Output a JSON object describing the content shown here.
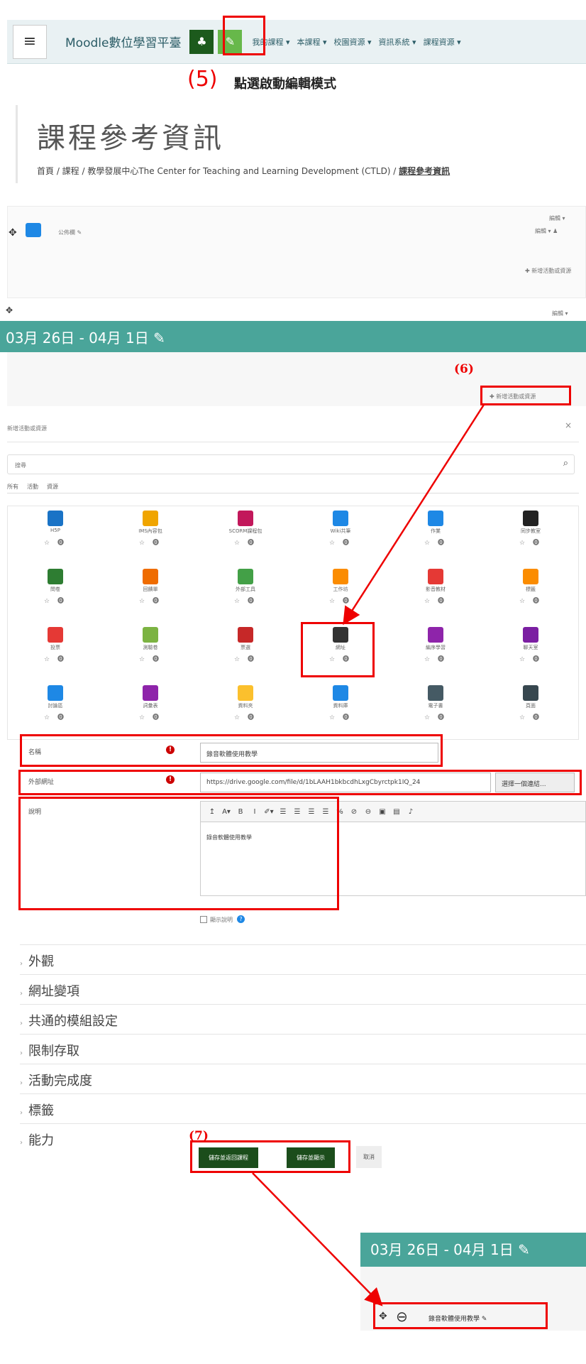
{
  "navbar": {
    "menu_icon": "hamburger-icon",
    "brand": "Moodle數位學習平臺",
    "menus": [
      "我的課程 ▾",
      "本課程 ▾",
      "校園資源 ▾",
      "資訊系統 ▾",
      "課程資源 ▾"
    ]
  },
  "annotations": {
    "step5_num": "(5)",
    "step5_text": "點選啟動編輯模式",
    "step6": "(6)",
    "step7": "(7)"
  },
  "course": {
    "title": "課程參考資訊",
    "breadcrumb": "首頁 / 課程 / 教學發展中心The Center for Teaching and Learning Development (CTLD) / ",
    "breadcrumb_current": "課程參考資訊"
  },
  "general_section": {
    "forum_label": "公佈欄 ✎",
    "edit_menu_1": "編輯 ▾",
    "edit_menu_2": "編輯 ▾ ♟",
    "add_activity": "✚ 新增活動或資源"
  },
  "week_section": {
    "edit_menu": "編輯 ▾",
    "title": "03月 26日 - 04月 1日 ✎",
    "add_activity": "✚ 新增活動或資源"
  },
  "chooser": {
    "title": "新增活動或資源",
    "close": "×",
    "search_placeholder": "搜尋",
    "tabs": [
      "所有",
      "活動",
      "資源"
    ],
    "items": [
      {
        "label": "H5P",
        "color": "#1a73c6"
      },
      {
        "label": "IMS內容包",
        "color": "#f0a500"
      },
      {
        "label": "SCORM課程包",
        "color": "#c2185b"
      },
      {
        "label": "Wiki共筆",
        "color": "#1e88e5"
      },
      {
        "label": "作業",
        "color": "#1e88e5"
      },
      {
        "label": "同步教室",
        "color": "#222222"
      },
      {
        "label": "問卷",
        "color": "#2e7d32"
      },
      {
        "label": "回饋單",
        "color": "#ef6c00"
      },
      {
        "label": "外部工具",
        "color": "#43a047"
      },
      {
        "label": "工作坊",
        "color": "#fb8c00"
      },
      {
        "label": "影音教材",
        "color": "#e53935"
      },
      {
        "label": "標籤",
        "color": "#fb8c00"
      },
      {
        "label": "投票",
        "color": "#e53935"
      },
      {
        "label": "測驗卷",
        "color": "#7cb342"
      },
      {
        "label": "票選",
        "color": "#c62828"
      },
      {
        "label": "網址",
        "color": "#333333"
      },
      {
        "label": "編序學習",
        "color": "#8e24aa"
      },
      {
        "label": "聊天室",
        "color": "#7b1fa2"
      },
      {
        "label": "討論區",
        "color": "#1e88e5"
      },
      {
        "label": "詞彙表",
        "color": "#8e24aa"
      },
      {
        "label": "資料夾",
        "color": "#fbc02d"
      },
      {
        "label": "資料庫",
        "color": "#1e88e5"
      },
      {
        "label": "電子書",
        "color": "#455a64"
      },
      {
        "label": "頁面",
        "color": "#37474f"
      }
    ],
    "star_info": "☆ ⓿"
  },
  "form": {
    "name_label": "名稱",
    "name_value": "錄音軟體使用教學",
    "url_label": "外部網址",
    "url_value": "https://drive.google.com/file/d/1bLAAH1bkbcdhLxgCbyrctpk1IQ_24",
    "choose_link": "選擇一個連結...",
    "desc_label": "說明",
    "desc_value": "錄音軟體使用教學",
    "show_desc": "顯示說明",
    "toolbar": [
      "↥",
      "A▾",
      "B",
      "I",
      "✐▾",
      "☰",
      "☰",
      "☰",
      "☰",
      "%",
      "⊘",
      "⊖",
      "▣",
      "▤",
      "♪"
    ]
  },
  "sections": [
    "外觀",
    "網址變項",
    "共通的模組設定",
    "限制存取",
    "活動完成度",
    "標籤",
    "能力"
  ],
  "buttons": {
    "save_return": "儲存並返回課程",
    "save_display": "儲存並顯示",
    "cancel": "取消"
  },
  "result": {
    "week_title": "03月 26日 - 04月 1日 ✎",
    "item_label": "錄音軟體使用教學 ✎"
  }
}
